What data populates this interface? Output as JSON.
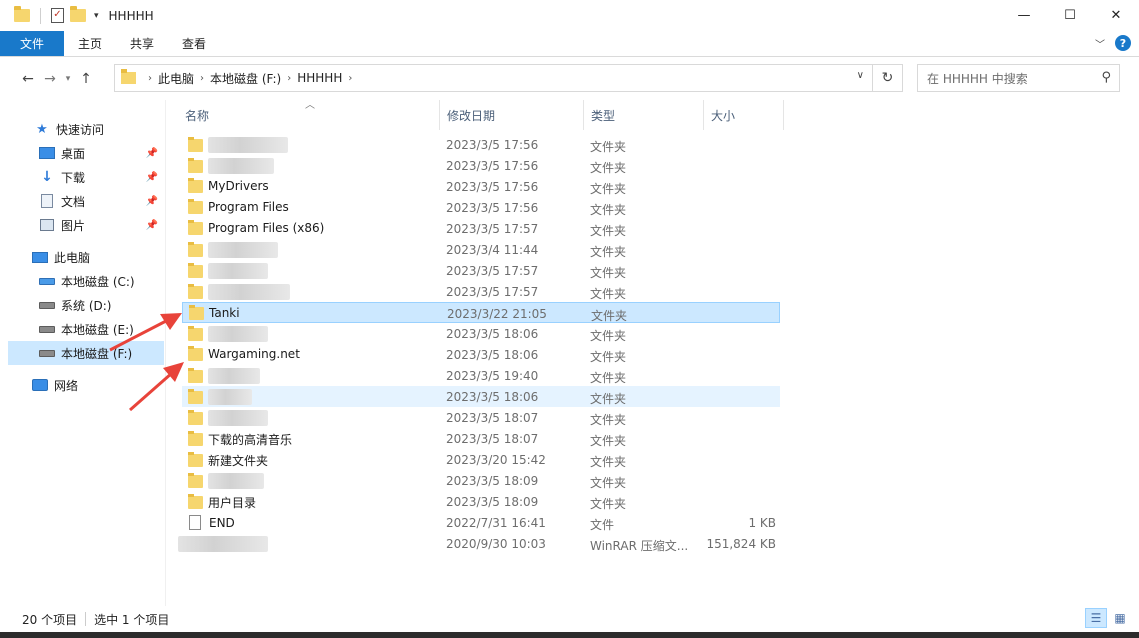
{
  "window": {
    "title": "HHHHH",
    "controls": {
      "minimize": "—",
      "maximize": "☐",
      "close": "✕"
    }
  },
  "ribbon": {
    "tabs": [
      "文件",
      "主页",
      "共享",
      "查看"
    ],
    "help": "?"
  },
  "address": {
    "crumbs": [
      "此电脑",
      "本地磁盘 (F:)",
      "HHHHH"
    ],
    "search_placeholder": "在 HHHHH 中搜索"
  },
  "columns": {
    "name": "名称",
    "date": "修改日期",
    "type": "类型",
    "size": "大小"
  },
  "nav": {
    "quick_access": "快速访问",
    "pinned": [
      "桌面",
      "下载",
      "文档",
      "图片"
    ],
    "this_pc": "此电脑",
    "drives": [
      "本地磁盘 (C:)",
      "系统 (D:)",
      "本地磁盘 (E:)",
      "本地磁盘 (F:)"
    ],
    "network": "网络"
  },
  "files": [
    {
      "name": "",
      "date": "2023/3/5 17:56",
      "type": "文件夹",
      "size": "",
      "kind": "folder",
      "redacted": true
    },
    {
      "name": "",
      "date": "2023/3/5 17:56",
      "type": "文件夹",
      "size": "",
      "kind": "folder",
      "redacted": true
    },
    {
      "name": "MyDrivers",
      "date": "2023/3/5 17:56",
      "type": "文件夹",
      "size": "",
      "kind": "folder"
    },
    {
      "name": "Program Files",
      "date": "2023/3/5 17:56",
      "type": "文件夹",
      "size": "",
      "kind": "folder"
    },
    {
      "name": "Program Files (x86)",
      "date": "2023/3/5 17:57",
      "type": "文件夹",
      "size": "",
      "kind": "folder"
    },
    {
      "name": "",
      "date": "2023/3/4 11:44",
      "type": "文件夹",
      "size": "",
      "kind": "folder",
      "redacted": true
    },
    {
      "name": "",
      "date": "2023/3/5 17:57",
      "type": "文件夹",
      "size": "",
      "kind": "folder",
      "redacted": true
    },
    {
      "name": "",
      "date": "2023/3/5 17:57",
      "type": "文件夹",
      "size": "",
      "kind": "folder",
      "redacted": true
    },
    {
      "name": "Tanki",
      "date": "2023/3/22 21:05",
      "type": "文件夹",
      "size": "",
      "kind": "folder",
      "state": "selected"
    },
    {
      "name": "",
      "date": "2023/3/5 18:06",
      "type": "文件夹",
      "size": "",
      "kind": "folder",
      "redacted": true
    },
    {
      "name": "Wargaming.net",
      "date": "2023/3/5 18:06",
      "type": "文件夹",
      "size": "",
      "kind": "folder"
    },
    {
      "name": "",
      "date": "2023/3/5 19:40",
      "type": "文件夹",
      "size": "",
      "kind": "folder",
      "redacted": true
    },
    {
      "name": "",
      "date": "2023/3/5 18:06",
      "type": "文件夹",
      "size": "",
      "kind": "folder",
      "redacted": true,
      "state": "hover"
    },
    {
      "name": "",
      "date": "2023/3/5 18:07",
      "type": "文件夹",
      "size": "",
      "kind": "folder",
      "redacted": true
    },
    {
      "name": "下载的高清音乐",
      "date": "2023/3/5 18:07",
      "type": "文件夹",
      "size": "",
      "kind": "folder"
    },
    {
      "name": "新建文件夹",
      "date": "2023/3/20 15:42",
      "type": "文件夹",
      "size": "",
      "kind": "folder"
    },
    {
      "name": "",
      "date": "2023/3/5 18:09",
      "type": "文件夹",
      "size": "",
      "kind": "folder",
      "redacted": true
    },
    {
      "name": "用户目录",
      "date": "2023/3/5 18:09",
      "type": "文件夹",
      "size": "",
      "kind": "folder"
    },
    {
      "name": "END",
      "date": "2022/7/31 16:41",
      "type": "文件",
      "size": "1 KB",
      "kind": "file"
    },
    {
      "name": "",
      "date": "2020/9/30 10:03",
      "type": "WinRAR 压缩文...",
      "size": "151,824 KB",
      "kind": "archive",
      "redacted": true
    }
  ],
  "status": {
    "count": "20 个项目",
    "selected": "选中 1 个项目"
  },
  "colors": {
    "accent": "#1979ca",
    "selection": "#cce8ff",
    "folder": "#f6d66e",
    "arrow": "#e8433a"
  }
}
